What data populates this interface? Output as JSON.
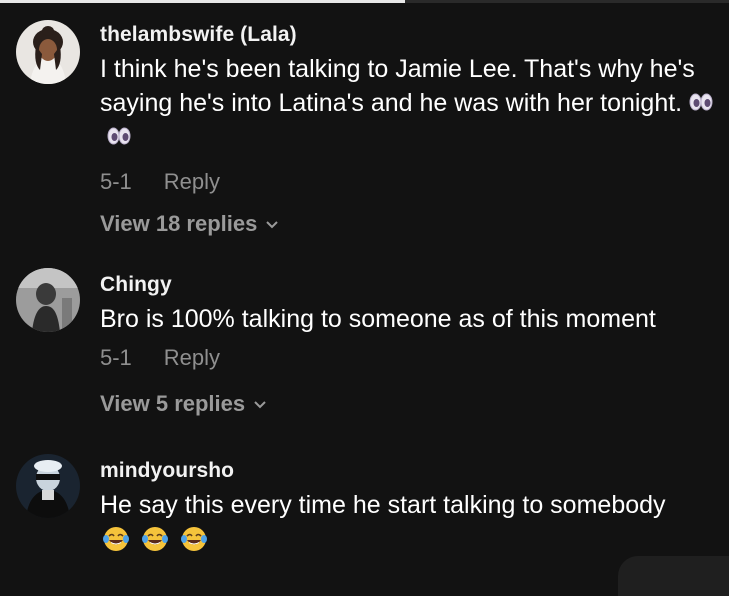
{
  "comments": [
    {
      "username": "thelambswife (Lala)",
      "text": "I think he's been talking to Jamie Lee. That's why he's saying he's into Latina's and he was with her tonight.",
      "emojis": [
        "eyes-emoji",
        "eyes-emoji"
      ],
      "date": "5-1",
      "reply_label": "Reply",
      "view_replies_label": "View 18 replies"
    },
    {
      "username": "Chingy",
      "text": "Bro is 100% talking to someone as of this moment",
      "date": "5-1",
      "reply_label": "Reply",
      "view_replies_label": "View 5 replies"
    },
    {
      "username": "mindyoursho",
      "text": "He say this every time he start talking to somebody",
      "emojis": [
        "tears-of-joy-emoji",
        "tears-of-joy-emoji",
        "tears-of-joy-emoji"
      ]
    }
  ],
  "progress": 0.555,
  "colors": {
    "background": "#121212",
    "text": "#ffffff",
    "muted": "#8f8f8f"
  }
}
